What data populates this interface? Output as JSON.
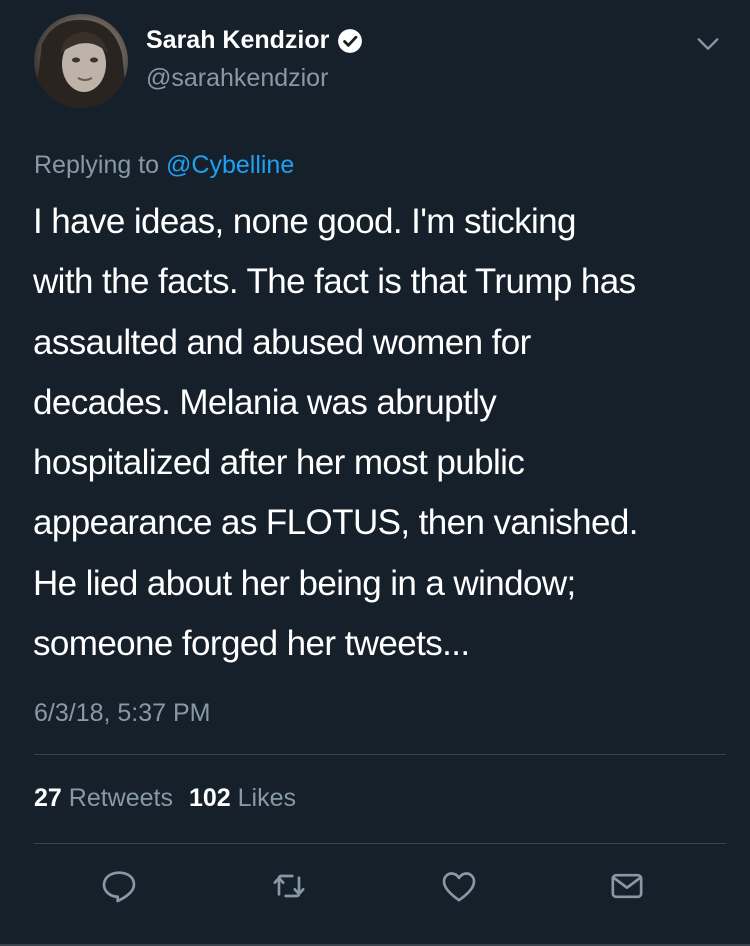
{
  "tweet": {
    "author": {
      "display_name": "Sarah Kendzior",
      "handle": "@sarahkendzior",
      "verified": true
    },
    "reply_prefix": "Replying to",
    "reply_mention": "@Cybelline",
    "text_lines": [
      "I have ideas, none good. I'm sticking",
      "with the facts. The fact is that Trump has",
      "assaulted and abused women for",
      "decades. Melania was abruptly",
      "hospitalized after her most public",
      "appearance as FLOTUS, then vanished.",
      "He lied about her being in a window;",
      "someone forged her tweets..."
    ],
    "timestamp": "6/3/18, 5:37 PM",
    "stats": {
      "retweets_count": "27",
      "retweets_label": "Retweets",
      "likes_count": "102",
      "likes_label": "Likes"
    }
  },
  "icons": {
    "verified": "verified-badge-icon",
    "menu": "chevron-down-icon",
    "reply": "reply-icon",
    "retweet": "retweet-icon",
    "like": "heart-icon",
    "share": "envelope-icon"
  },
  "colors": {
    "background": "#15202b",
    "text": "#ffffff",
    "secondary_text": "#8899a6",
    "link": "#1da1f2",
    "divider": "#38444d"
  }
}
